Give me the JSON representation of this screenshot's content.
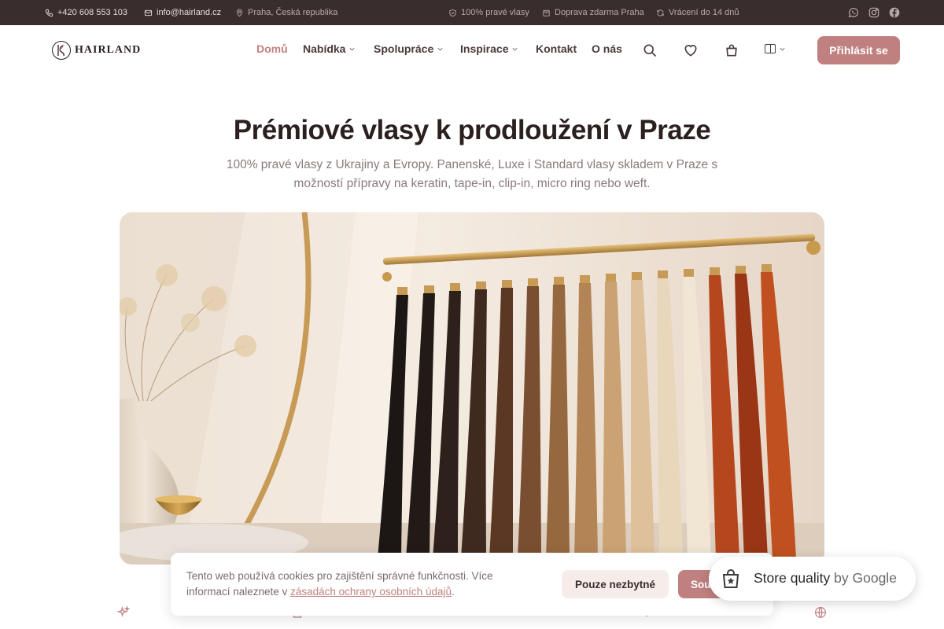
{
  "topbar": {
    "phone": "+420 608 553 103",
    "email": "info@hairland.cz",
    "location": "Praha, Česká republika",
    "badges": [
      "100% pravé vlasy",
      "Doprava zdarma Praha",
      "Vrácení do 14 dnů"
    ],
    "social": [
      "whatsapp-icon",
      "instagram-icon",
      "facebook-icon"
    ]
  },
  "header": {
    "logo_text": "HAIRLAND",
    "nav": [
      {
        "label": "Domů",
        "active": true
      },
      {
        "label": "Nabídka",
        "dropdown": true
      },
      {
        "label": "Spolupráce",
        "dropdown": true
      },
      {
        "label": "Inspirace",
        "dropdown": true
      },
      {
        "label": "Kontakt"
      },
      {
        "label": "O nás"
      }
    ],
    "icons": [
      "search-icon",
      "heart-icon",
      "bag-icon"
    ],
    "login_label": "Přihlásit se"
  },
  "hero": {
    "title": "Prémiové vlasy k prodloužení v Praze",
    "subtitle": "100% pravé vlasy z Ukrajiny a Evropy. Panenské, Luxe i Standard vlasy skladem v Praze s možností přípravy na keratin, tape-in, clip-in, micro ring nebo weft."
  },
  "cookie": {
    "text": "Tento web používá cookies pro zajištění správné funkčnosti. Více informací naleznete v ",
    "link": "zásadách ochrany osobních údajů",
    "text_end": ".",
    "necessary_label": "Pouze nezbytné",
    "agree_label": "Souhlasím"
  },
  "google_badge": {
    "label": "Store quality",
    "by": "by Google"
  },
  "colors": {
    "accent": "#c0807f",
    "topbar_bg": "#3a2d2d",
    "text_dark": "#2b1f1f"
  }
}
